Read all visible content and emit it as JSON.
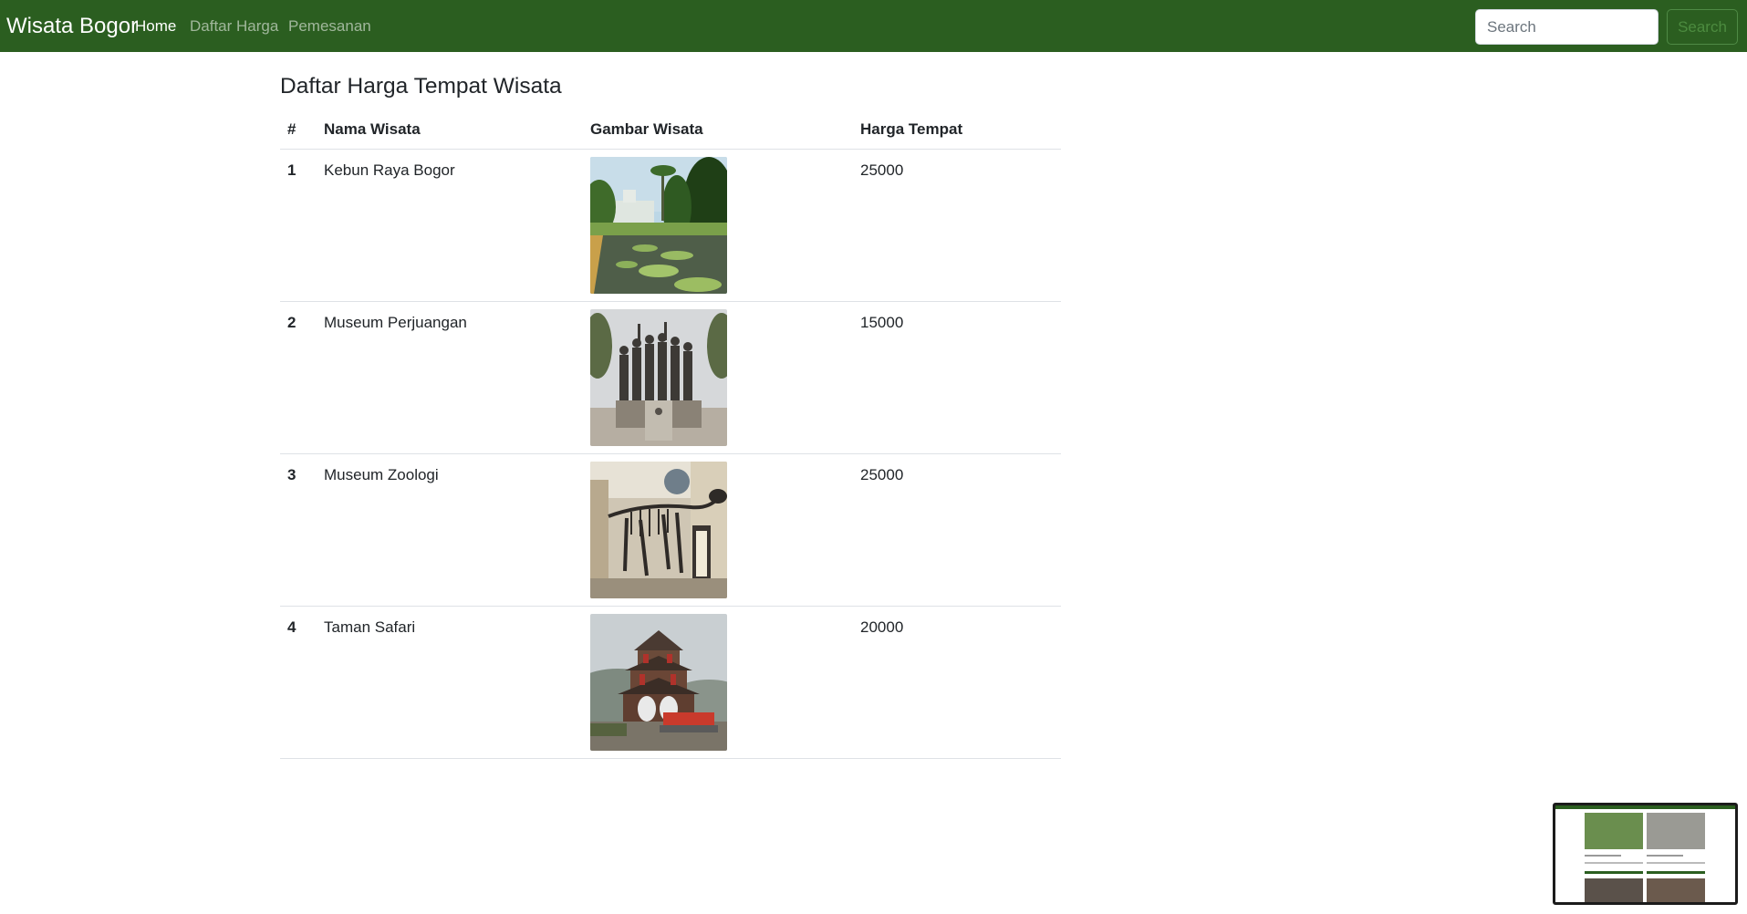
{
  "navbar": {
    "brand": "Wisata Bogor",
    "links": [
      {
        "label": "Home",
        "active": true
      },
      {
        "label": "Daftar Harga",
        "active": false
      },
      {
        "label": "Pemesanan",
        "active": false
      }
    ],
    "search_placeholder": "Search",
    "search_button": "Search"
  },
  "page": {
    "title": "Daftar Harga Tempat Wisata"
  },
  "table": {
    "headers": [
      "#",
      "Nama Wisata",
      "Gambar Wisata",
      "Harga Tempat"
    ],
    "rows": [
      {
        "no": "1",
        "nama": "Kebun Raya Bogor",
        "gambar": "kebun-raya-photo",
        "harga": "25000"
      },
      {
        "no": "2",
        "nama": "Museum Perjuangan",
        "gambar": "museum-perjuangan-photo",
        "harga": "15000"
      },
      {
        "no": "3",
        "nama": "Museum Zoologi",
        "gambar": "museum-zoologi-photo",
        "harga": "25000"
      },
      {
        "no": "4",
        "nama": "Taman Safari",
        "gambar": "taman-safari-photo",
        "harga": "20000"
      }
    ]
  },
  "colors": {
    "navbar": "#2b5e20",
    "search_button_text": "#4c8b3f"
  }
}
